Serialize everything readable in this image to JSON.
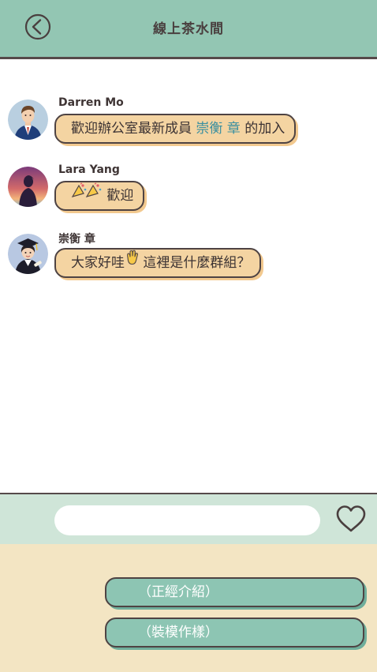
{
  "header": {
    "title": "線上茶水間",
    "back_icon": "circle-chevron-left-icon",
    "background_color": "#93c6b3"
  },
  "messages": [
    {
      "sender": "Darren Mo",
      "avatar": "businessman-avatar",
      "text_before": "歡迎辦公室最新成員 ",
      "mention": "崇衡 章",
      "text_after": " 的加入"
    },
    {
      "sender": "Lara Yang",
      "avatar": "silhouette-sunset-avatar",
      "emoji": "party-popper-icons",
      "text": " 歡迎"
    },
    {
      "sender": "崇衡 章",
      "avatar": "graduate-avatar",
      "text_before": "大家好哇",
      "emoji": "waving-hand-icon",
      "text_after": " 這裡是什麼群組？"
    }
  ],
  "composer": {
    "input_value": "",
    "heart_icon": "heart-outline-icon"
  },
  "reply_options": [
    {
      "label": "（正經介紹）"
    },
    {
      "label": "（裝模作樣）"
    }
  ],
  "colors": {
    "bubble": "#f4d4a2",
    "mention": "#3a8fa0",
    "reply_button": "#8dc5b3",
    "reply_panel": "#f3e5c3",
    "composer_bar": "#cfe5d8"
  }
}
